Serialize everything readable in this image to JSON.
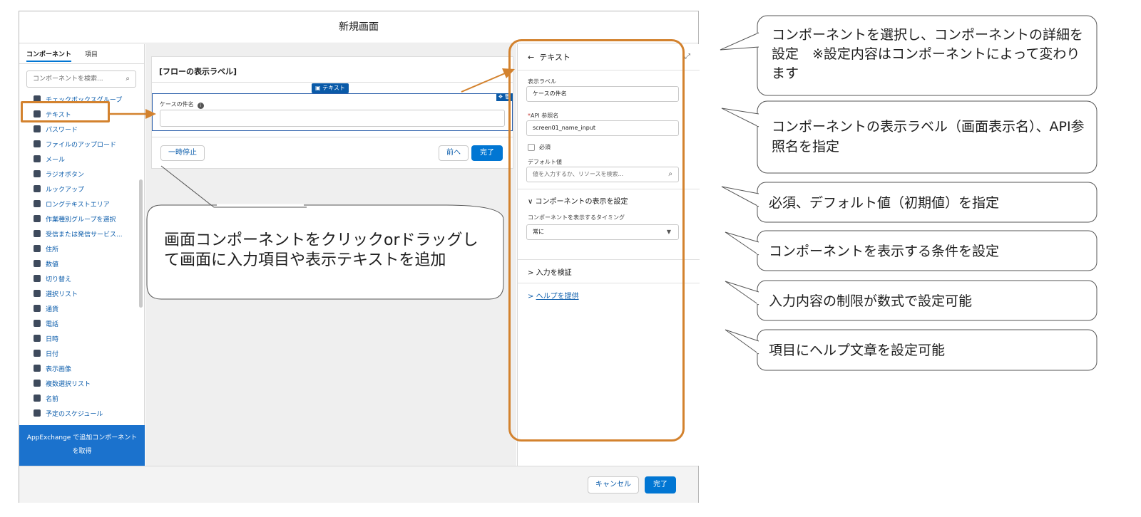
{
  "colors": {
    "brand": "#0176d3",
    "highlight_orange": "#d3822e",
    "palette_banner": "#1b72cd",
    "link": "#0b5cab"
  },
  "modal": {
    "title": "新規画面",
    "footer": {
      "cancel_label": "キャンセル",
      "done_label": "完了"
    }
  },
  "palette": {
    "tab_components": "コンポーネント",
    "tab_fields": "項目",
    "search_placeholder": "コンポーネントを検索...",
    "search_icon": "search-icon",
    "items": [
      {
        "label": "チェックボックスグループ"
      },
      {
        "label": "テキスト"
      },
      {
        "label": "パスワード"
      },
      {
        "label": "ファイルのアップロード"
      },
      {
        "label": "メール"
      },
      {
        "label": "ラジオボタン"
      },
      {
        "label": "ルックアップ"
      },
      {
        "label": "ロングテキストエリア"
      },
      {
        "label": "作業種別グループを選択"
      },
      {
        "label": "受信または発信サービス..."
      },
      {
        "label": "住所"
      },
      {
        "label": "数値"
      },
      {
        "label": "切り替え"
      },
      {
        "label": "選択リスト"
      },
      {
        "label": "通貨"
      },
      {
        "label": "電話"
      },
      {
        "label": "日時"
      },
      {
        "label": "日付"
      },
      {
        "label": "表示画像"
      },
      {
        "label": "複数選択リスト"
      },
      {
        "label": "名前"
      },
      {
        "label": "予定のスケジュール"
      }
    ],
    "appexchange_label": "AppExchange で追加コンポーネントを取得"
  },
  "canvas": {
    "screen_title": "[フローの表示ラベル]",
    "component_chip": "テキスト",
    "component_tools": "✥ 🗑",
    "component_label": "ケースの件名",
    "pause_label": "一時停止",
    "previous_label": "前へ",
    "finish_label": "完了"
  },
  "properties": {
    "header": "テキスト",
    "display_label_label": "表示ラベル",
    "display_label_value": "ケースの件名",
    "api_name_label": "API 参照名",
    "api_name_value": "screen01_name_input",
    "required_label": "必須",
    "default_label": "デフォルト値",
    "default_placeholder": "値を入力するか、リソースを検索...",
    "visibility_section": "コンポーネントの表示を設定",
    "visibility_timing_label": "コンポーネントを表示するタイミング",
    "visibility_timing_value": "常に",
    "validate_section": "入力を検証",
    "help_section": "ヘルプを提供"
  },
  "callouts": {
    "canvas": "画面コンポーネントをクリックorドラッグして画面に入力項目や表示テキストを追加",
    "select": "コンポーネントを選択し、コンポーネントの詳細を設定　※設定内容はコンポーネントによって変わります",
    "label": "コンポーネントの表示ラベル（画面表示名）、API参照名を指定",
    "required": "必須、デフォルト値（初期値）を指定",
    "visibility": "コンポーネントを表示する条件を設定",
    "validate": "入力内容の制限が数式で設定可能",
    "help": "項目にヘルプ文章を設定可能"
  }
}
